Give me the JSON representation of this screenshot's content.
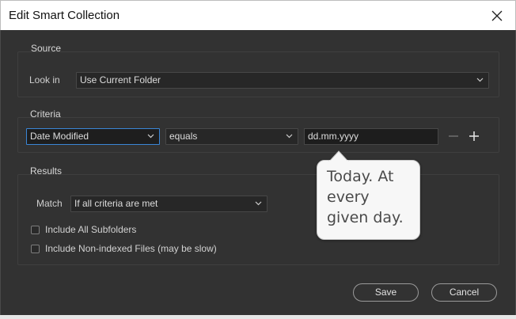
{
  "window": {
    "title": "Edit Smart Collection"
  },
  "source": {
    "group_label": "Source",
    "look_in_label": "Look in",
    "look_in_value": "Use Current Folder"
  },
  "criteria": {
    "group_label": "Criteria",
    "field_value": "Date Modified",
    "operator_value": "equals",
    "value_text": "dd.mm.yyyy"
  },
  "results": {
    "group_label": "Results",
    "match_label": "Match",
    "match_value": "If all criteria are met",
    "checkboxes": [
      {
        "label": "Include All Subfolders",
        "checked": false
      },
      {
        "label": "Include Non-indexed Files (may be slow)",
        "checked": false
      }
    ]
  },
  "tooltip": {
    "text": "Today. At every given day."
  },
  "buttons": {
    "save": "Save",
    "cancel": "Cancel"
  },
  "colors": {
    "accent": "#3a86d6",
    "panel": "#323232",
    "field": "#272727"
  }
}
